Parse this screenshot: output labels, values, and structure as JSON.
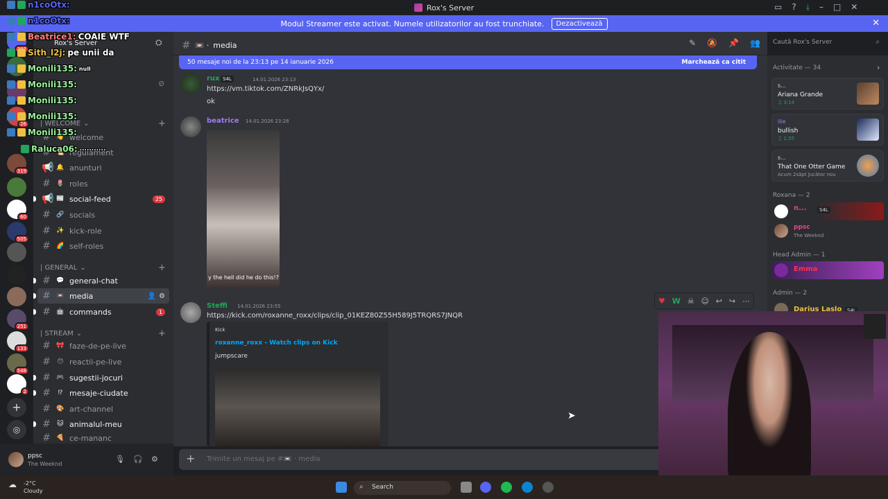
{
  "window": {
    "title": "Rox's Server"
  },
  "banner": {
    "text": "Modul Streamer este activat. Numele utilizatorilor au fost trunchiate.",
    "button": "Dezactivează"
  },
  "server_rail": {
    "badges": [
      "302",
      "26",
      "319",
      "60",
      "505",
      "251",
      "133",
      "548",
      "2"
    ]
  },
  "sidebar": {
    "server_name": "Rox's Server",
    "categories": [
      {
        "label": "| WELCOME"
      },
      {
        "label": "| GENERAL"
      },
      {
        "label": "| STREAM"
      }
    ],
    "channels": [
      {
        "label": "welcome",
        "emoji": "👋"
      },
      {
        "label": "regulament",
        "emoji": "📜"
      },
      {
        "label": "anunturi",
        "emoji": "🔔"
      },
      {
        "label": "roles",
        "emoji": "🌷"
      },
      {
        "label": "social-feed",
        "emoji": "📰",
        "count": "25"
      },
      {
        "label": "socials",
        "emoji": "🔗"
      },
      {
        "label": "kick-role",
        "emoji": "✨"
      },
      {
        "label": "self-roles",
        "emoji": "🌈"
      },
      {
        "label": "general-chat",
        "emoji": "💬"
      },
      {
        "label": "media",
        "emoji": "📼"
      },
      {
        "label": "commands",
        "emoji": "🤖",
        "count": "1"
      },
      {
        "label": "faze-de-pe-live",
        "emoji": "🎀"
      },
      {
        "label": "reactii-pe-live",
        "emoji": "😯"
      },
      {
        "label": "sugestii-jocuri",
        "emoji": "🎮"
      },
      {
        "label": "mesaje-ciudate",
        "emoji": "⁉"
      },
      {
        "label": "art-channel",
        "emoji": "🎨"
      },
      {
        "label": "animalul-meu",
        "emoji": "🐱"
      },
      {
        "label": "ce-mananc",
        "emoji": "🍕"
      }
    ]
  },
  "user_panel": {
    "name": "ppsc",
    "status": "The Weeknd"
  },
  "header": {
    "channel": "media",
    "search_placeholder": "Caută Rox's Server"
  },
  "chat": {
    "new_messages": "50 mesaje noi de la 23:13 pe 14 ianuarie 2026",
    "mark_read": "Marchează ca citit",
    "messages": [
      {
        "author": "rux",
        "tag": "S4L",
        "time": "14.01.2026 23:13",
        "link": "https://vm.tiktok.com/ZNRkJsQYx/",
        "text": "ok"
      },
      {
        "author": "beatrice",
        "time": "14.01.2026 23:28",
        "caption": "y the hell did he do this!?"
      },
      {
        "author": "Steffi",
        "time": "14.01.2026 23:55",
        "link": "https://kick.com/roxanne_roxx/clips/clip_01KEZ80Z55H589J5TRQRS7JNQR"
      }
    ],
    "embed": {
      "provider": "Kick",
      "title": "roxanne_roxx - Watch clips on Kick",
      "description": "jumpscare"
    },
    "composer_placeholder": "Trimite un mesaj pe #📼 · media"
  },
  "members": {
    "activity_header": "Activitate — 34",
    "activities": [
      {
        "user": "s...",
        "title": "Ariana Grande",
        "detail": "♫ 3:14"
      },
      {
        "user": "llie",
        "title": "bullish",
        "detail": "♫ 1:55"
      },
      {
        "user": "s...",
        "title": "That One Otter Game",
        "detail": "Acum 2săpt  Jucător nou"
      }
    ],
    "groups": [
      {
        "label": "Roxana — 2"
      },
      {
        "label": "Head Admin — 1"
      },
      {
        "label": "Admin — 2"
      }
    ],
    "people": [
      {
        "name": "n...",
        "tag": "S4L"
      },
      {
        "name": "ppsc",
        "status": "The Weeknd"
      },
      {
        "name": "Emma"
      },
      {
        "name": "Darius Laslo",
        "tag": "S4L"
      }
    ]
  },
  "overlay_chat": [
    {
      "user": "n1coOtx:",
      "text": ""
    },
    {
      "user": "n1coOtx:",
      "text": ""
    },
    {
      "user": "Beatrice1:",
      "text": "COAIE WTF"
    },
    {
      "user": "Sith_l2j:",
      "text": "pe unii da"
    },
    {
      "user": "Monili135:",
      "text": "null"
    },
    {
      "user": "Monili135:",
      "text": ""
    },
    {
      "user": "Monili135:",
      "text": ""
    },
    {
      "user": "Monili135:",
      "text": ""
    },
    {
      "user": "Monili135:",
      "text": ""
    },
    {
      "user": "Raluca06:",
      "text": "...........",
      "note": ""
    }
  ],
  "taskbar": {
    "temp": "-2°C",
    "weather": "Cloudy",
    "search": "Search"
  },
  "colors": {
    "accent": "#5865f2",
    "danger": "#da373c",
    "link": "#00a8fc"
  }
}
